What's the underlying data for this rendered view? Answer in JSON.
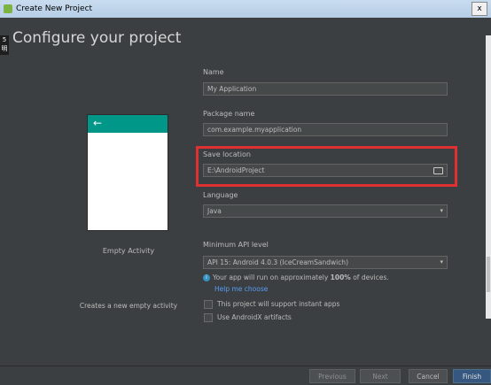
{
  "window": {
    "title": "Create New Project",
    "close_label": "x"
  },
  "side_tab": {
    "label": "5\n明"
  },
  "page": {
    "heading": "Configure your project"
  },
  "template": {
    "name": "Empty Activity",
    "description": "Creates a new empty activity",
    "toolbar_color": "#009688",
    "back_icon": "←"
  },
  "form": {
    "name_label": "Name",
    "name_value": "My Application",
    "package_label": "Package name",
    "package_value": "com.example.myapplication",
    "save_label": "Save location",
    "save_value": "E:\\AndroidProject",
    "language_label": "Language",
    "language_value": "Java",
    "min_api_label": "Minimum API level",
    "min_api_value": "API 15: Android 4.0.3 (IceCreamSandwich)",
    "info_text_pre": "Your app will run on approximately ",
    "info_percent": "100%",
    "info_text_post": " of devices.",
    "help_link": "Help me choose",
    "instant_apps_label": "This project will support instant apps",
    "androidx_label": "Use AndroidX artifacts",
    "dropdown_icon": "▾",
    "folder_icon": "folder-icon"
  },
  "buttons": {
    "previous": "Previous",
    "next": "Next",
    "cancel": "Cancel",
    "finish": "Finish"
  },
  "colors": {
    "highlight": "#e03030",
    "link": "#589df6",
    "primary_button": "#365880"
  }
}
